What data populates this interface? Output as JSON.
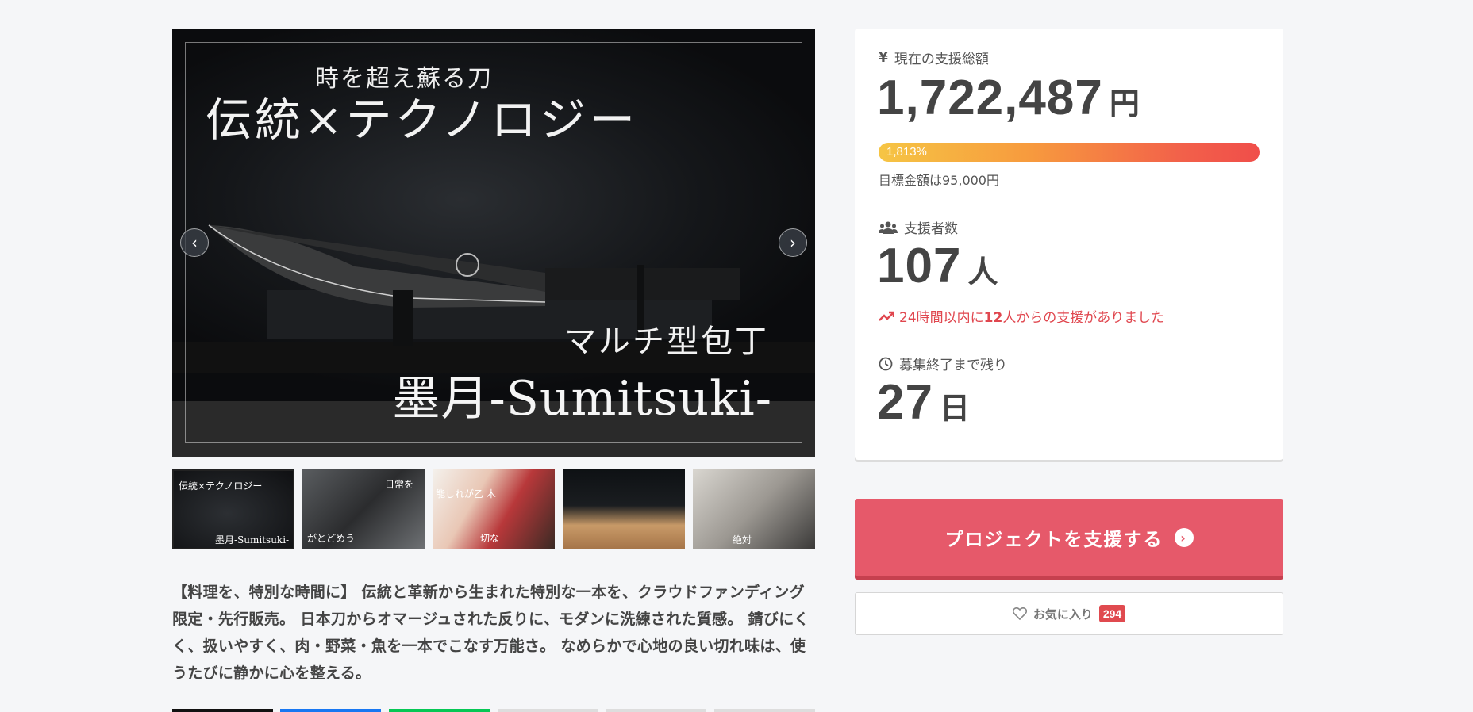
{
  "hero": {
    "subtitle": "時を超え蘇る刀",
    "title": "伝統×テクノロジー",
    "kana": "マルチ型包丁",
    "name": "墨月-Sumitsuki-",
    "prev_icon": "‹",
    "next_icon": "›"
  },
  "thumbnails": [
    {
      "caption_1": "伝統×テクノロジー",
      "caption_2": "墨月-Sumitsuki-"
    },
    {
      "caption_1": "日常を",
      "caption_2": "がとどめう"
    },
    {
      "caption_1": "能しれが乙 木",
      "caption_2": "切な"
    },
    {
      "caption_1": "",
      "caption_2": ""
    },
    {
      "caption_1": "",
      "caption_2": "絶対"
    }
  ],
  "description": "【料理を、特別な時間に】 伝統と革新から生まれた特別な一本を、クラウドファンディング限定・先行販売。 日本刀からオマージュされた反りに、モダンに洗練された質感。 錆びにくく、扱いやすく、肉・野菜・魚を一本でこなす万能さ。 なめらかで心地の良い切れ味は、使うたびに静かに心を整える。",
  "share_colors": [
    "#111111",
    "#1877f2",
    "#06c755",
    "#dddddd",
    "#dddddd",
    "#dddddd"
  ],
  "stats": {
    "total": {
      "icon": "yen-icon",
      "label": "現在の支援総額",
      "amount": "1,722,487",
      "unit": "円",
      "progress_text": "1,813%",
      "progress_fraction": 1.0,
      "goal_text": "目標金額は95,000円"
    },
    "backers": {
      "icon": "users-icon",
      "label": "支援者数",
      "count": "107",
      "unit": "人",
      "trend_prefix": "24時間以内に",
      "trend_count": "12",
      "trend_suffix": "人からの支援がありました"
    },
    "remaining": {
      "icon": "clock-icon",
      "label": "募集終了まで残り",
      "days": "27",
      "unit": "日"
    }
  },
  "actions": {
    "support_label": "プロジェクトを支援する",
    "favorite_label": "お気に入り",
    "favorite_count": "294"
  },
  "colors": {
    "support_button": "#e6596a",
    "trend": "#e0464e",
    "favorite_badge": "#e04a4f"
  }
}
